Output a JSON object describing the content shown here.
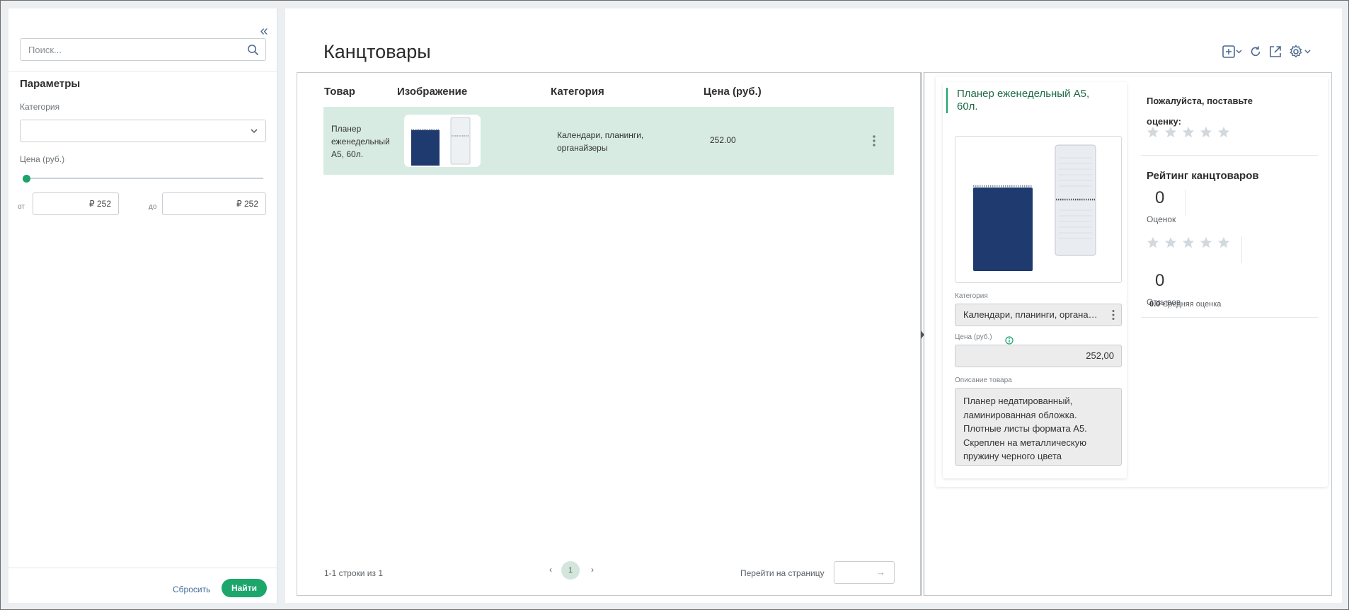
{
  "sidebar": {
    "search_placeholder": "Поиск...",
    "params_title": "Параметры",
    "category_label": "Категория",
    "category_value": "",
    "price_label": "Цена (руб.)",
    "from_label": "от",
    "to_label": "до",
    "price_from": "₽ 252",
    "price_to": "₽ 252",
    "slider_position": 0,
    "reset_label": "Сбросить",
    "find_label": "Найти"
  },
  "main": {
    "title": "Канцтовары",
    "columns": [
      "Товар",
      "Изображение",
      "Категория",
      "Цена (руб.)"
    ],
    "rows": [
      {
        "name": "Планер еженедельный А5, 60л.",
        "category": "Календари, планинги, органайзеры",
        "price": "252.00"
      }
    ],
    "rows_info": "1-1 строки из 1",
    "current_page": "1",
    "goto_label": "Перейти на страницу",
    "goto_value": ""
  },
  "detail": {
    "title": "Планер еженедельный А5, 60л.",
    "category_label": "Категория",
    "category_value": "Календари, планинги, органайзеры",
    "price_label": "Цена (руб.)",
    "price_value": "252,00",
    "description_label": "Описание товара",
    "description": "Планер недатированный, ламинированная обложка. Плотные листы формата А5. Скреплен на металлическую пружину черного цвета"
  },
  "rating": {
    "prompt": "Пожалуйста, поставьте оценку:",
    "user_stars": 0,
    "title": "Рейтинг канцтоваров",
    "ratings_count": "0",
    "ratings_label": "Оценок",
    "average_stars": 0,
    "average_value": "0.0",
    "average_label": "Средняя оценка",
    "reviews_count": "0",
    "reviews_label": "Отзывов"
  },
  "colors": {
    "accent": "#1ca66c",
    "row_selected": "#d8ebe3",
    "link": "#3e6b9a",
    "star_empty": "#d3d8dd",
    "notebook_blue": "#1e3a6e"
  }
}
